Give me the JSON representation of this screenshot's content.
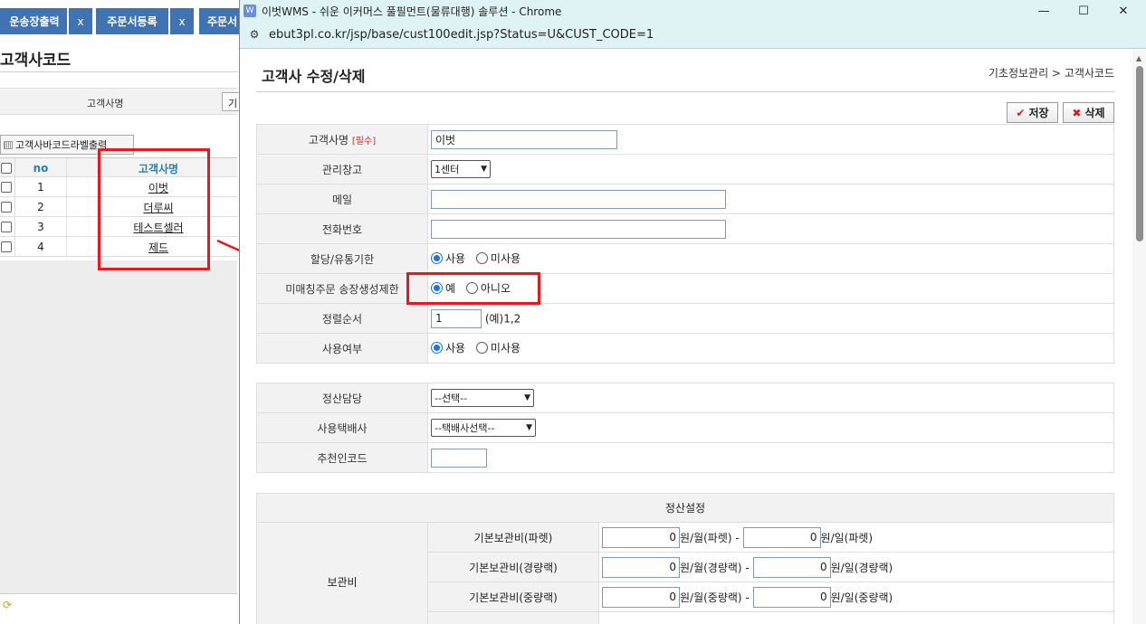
{
  "background": {
    "tabs": [
      {
        "label": "운송장출력",
        "close": "x"
      },
      {
        "label": "주문서등록",
        "close": "x"
      },
      {
        "label": "주문서"
      }
    ],
    "page_title": "고객사코드",
    "search_label": "고객사명",
    "search_value": "기",
    "barcode_button": "고객사바코드라벨출력",
    "grid": {
      "headers": {
        "no": "no",
        "name": "고객사명"
      },
      "rows": [
        {
          "no": "1",
          "name": "이벗"
        },
        {
          "no": "2",
          "name": "더루씨"
        },
        {
          "no": "3",
          "name": "테스트셀러"
        },
        {
          "no": "4",
          "name": "제드"
        }
      ]
    }
  },
  "popup": {
    "window_title": "이벗WMS - 쉬운 이커머스 풀필먼트(물류대행) 솔루션 - Chrome",
    "url": "ebut3pl.co.kr/jsp/base/cust100edit.jsp?Status=U&CUST_CODE=1",
    "page_title": "고객사 수정/삭제",
    "breadcrumb": "기초정보관리 > 고객사코드",
    "save_label": "저장",
    "delete_label": "삭제",
    "form": {
      "cust_name_label": "고객사명",
      "required_tag": "[필수]",
      "cust_name_value": "이벗",
      "warehouse_label": "관리창고",
      "warehouse_value": "1센터",
      "email_label": "메일",
      "email_value": "",
      "phone_label": "전화번호",
      "phone_value": "",
      "alloc_label": "할당/유통기한",
      "alloc_opt_yes": "사용",
      "alloc_opt_no": "미사용",
      "unmatched_label": "미매칭주문 송장생성제한",
      "unmatched_opt_yes": "예",
      "unmatched_opt_no": "아니오",
      "sort_label": "정렬순서",
      "sort_value": "1",
      "sort_hint": "(예)1,2",
      "use_label": "사용여부",
      "use_opt_yes": "사용",
      "use_opt_no": "미사용"
    },
    "form2": {
      "settle_mgr_label": "정산담당",
      "settle_mgr_value": "--선택--",
      "courier_label": "사용택배사",
      "courier_value": "--택배사선택--",
      "referrer_label": "추천인코드",
      "referrer_value": ""
    },
    "settlement": {
      "header": "정산설정",
      "group_label": "보관비",
      "rows": [
        {
          "label": "기본보관비(파렛)",
          "v1": "0",
          "u1": "원/월(파렛) -",
          "v2": "0",
          "u2": "원/일(파렛)"
        },
        {
          "label": "기본보관비(경량랙)",
          "v1": "0",
          "u1": "원/월(경량랙) -",
          "v2": "0",
          "u2": "원/일(경량랙)"
        },
        {
          "label": "기본보관비(중량랙)",
          "v1": "0",
          "u1": "원/월(중량랙) -",
          "v2": "0",
          "u2": "원/일(중량랙)"
        }
      ]
    }
  }
}
